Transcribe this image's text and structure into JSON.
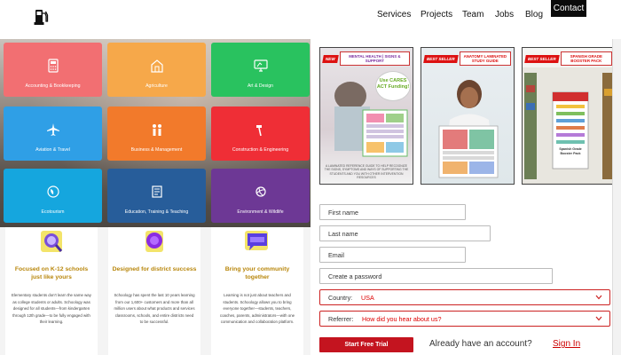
{
  "header": {
    "logo_icon": "gas-pump-icon",
    "nav": [
      "Services",
      "Projects",
      "Team",
      "Jobs",
      "Blog"
    ],
    "contact_label": "Contact"
  },
  "categories": [
    {
      "label": "Accounting & Bookkeeping",
      "color": "#f26f72",
      "icon": "calculator-icon"
    },
    {
      "label": "Agriculture",
      "color": "#f6a84a",
      "icon": "barn-icon"
    },
    {
      "label": "Art & Design",
      "color": "#29c25f",
      "icon": "monitor-icon"
    },
    {
      "label": "Aviation & Travel",
      "color": "#2f9fe6",
      "icon": "airplane-icon"
    },
    {
      "label": "Business & Management",
      "color": "#f27a2b",
      "icon": "people-icon"
    },
    {
      "label": "Construction & Engineering",
      "color": "#ef2e36",
      "icon": "hammer-icon"
    },
    {
      "label": "Ecotourism",
      "color": "#15a6de",
      "icon": "leaf-globe-icon"
    },
    {
      "label": "Education, Training & Teaching",
      "color": "#275d9a",
      "icon": "book-icon"
    },
    {
      "label": "Environment & Wildlife",
      "color": "#6d3895",
      "icon": "planet-icon"
    }
  ],
  "features": [
    {
      "title": "Focused on K-12 schools just like yours",
      "body": "Elementary students don't learn the same way as college students or adults. Schoology was designed for all students—from kindergarten through 12th grade—to be fully engaged with their learning.",
      "icon_color": "#6a3fd1"
    },
    {
      "title": "Designed for district success",
      "body": "Schoology has spent the last 10 years learning from our 1,600+ customers and more than all million users about what products and services classrooms, schools, and entire districts need to be successful.",
      "icon_color": "#8a2be2"
    },
    {
      "title": "Bring your community together",
      "body": "Learning is not just about teachers and students. Schoology allows you to bring everyone together—students, teachers, coaches, parents, administrators—with one communication and collaboration platform.",
      "icon_color": "#5a3fe0"
    }
  ],
  "products": [
    {
      "badge": "NEW",
      "title": "MENTAL HEALTH | SIGNS & SUPPORT",
      "note": "Use CARES ACT Funding!",
      "footer": "A LAMINATED REFERENCE GUIDE TO HELP RECOGNIZE THE SIGNS, SYMPTOMS AND WAYS OF SUPPORTING THE STUDENTS AND YOU WITH OTHER INTERVENTION RESOURCES"
    },
    {
      "badge": "BEST SELLER",
      "title": "ANATOMY LAMINATED STUDY GUIDE",
      "note": "",
      "footer": ""
    },
    {
      "badge": "BEST SELLER",
      "title": "SPANISH GRADE BOOSTER PACK",
      "note": "Spanish Grade Booster Pack",
      "footer": ""
    }
  ],
  "form": {
    "first_name": "First name",
    "last_name": "Last name",
    "email": "Email",
    "password": "Create a password",
    "country_label": "Country:",
    "country_value": "USA",
    "referrer_label": "Referrer:",
    "referrer_value": "How did you hear about us?",
    "submit": "Start Free Trial",
    "already": "Already have an account?",
    "signin": "Sign In"
  }
}
